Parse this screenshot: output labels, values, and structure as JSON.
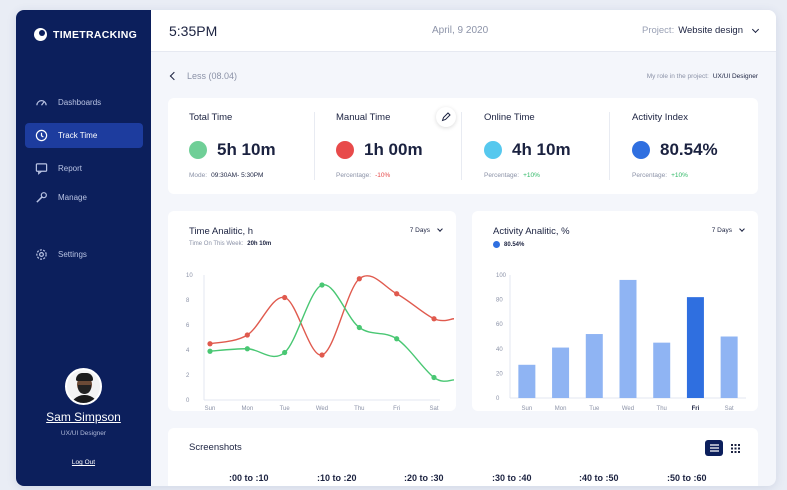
{
  "app": {
    "logo_text": "TIMETRACKING",
    "time": "5:35PM",
    "date": "April, 9 2020",
    "project_label": "Project:",
    "project_value": "Website design"
  },
  "sidebar": {
    "items": [
      {
        "label": "Dashboards",
        "icon": "speedometer-icon",
        "active": false
      },
      {
        "label": "Track Time",
        "icon": "clock-icon",
        "active": true
      },
      {
        "label": "Report",
        "icon": "chat-icon",
        "active": false
      },
      {
        "label": "Manage",
        "icon": "wrench-icon",
        "active": false
      },
      {
        "label": "Settings",
        "icon": "gear-icon",
        "active": false
      }
    ],
    "user_name": "Sam Simpson",
    "user_role": "UX/UI Designer",
    "logout": "Log Out"
  },
  "subheader": {
    "back_label": "Less (08.04)",
    "role_label": "My role in the project:",
    "role_value": "UX/UI Designer"
  },
  "stats": [
    {
      "title": "Total Time",
      "value": "5h 10m",
      "color": "#6fcf97",
      "sub_label": "Mode:",
      "sub_value": "09:30AM- 5:30PM",
      "sub_kind": "v"
    },
    {
      "title": "Manual Time",
      "value": "1h 00m",
      "color": "#e84a4a",
      "sub_label": "Percentage:",
      "sub_value": "-10%",
      "sub_kind": "neg"
    },
    {
      "title": "Online Time",
      "value": "4h 10m",
      "color": "#56c8ee",
      "sub_label": "Percentage:",
      "sub_value": "+10%",
      "sub_kind": "pos"
    },
    {
      "title": "Activity Index",
      "value": "80.54%",
      "color": "#2f6fe0",
      "sub_label": "Percentage:",
      "sub_value": "+10%",
      "sub_kind": "pos"
    }
  ],
  "time_card": {
    "title": "Time Analitic, h",
    "sub_label": "Time On This Week:",
    "sub_value": "20h 10m",
    "range": "7 Days"
  },
  "activity_card": {
    "title": "Activity Analitic, %",
    "legend": "80.54%",
    "range": "7 Days"
  },
  "chart_data": [
    {
      "type": "line",
      "x": [
        "Sun",
        "Mon",
        "Tue",
        "Wed",
        "Thu",
        "Fri",
        "Sat"
      ],
      "ylim": [
        0,
        10
      ],
      "yticks": [
        0,
        2,
        4,
        6,
        8,
        10
      ],
      "series": [
        {
          "color": "#e05a4e",
          "values": [
            4.5,
            5.2,
            8.2,
            3.6,
            9.7,
            8.5,
            6.5
          ],
          "end": 6.5
        },
        {
          "color": "#49c773",
          "values": [
            3.9,
            4.1,
            3.8,
            9.2,
            5.8,
            4.9,
            1.8
          ],
          "end": 1.6
        }
      ]
    },
    {
      "type": "bar",
      "categories": [
        "Sun",
        "Mon",
        "Tue",
        "Wed",
        "Thu",
        "Fri",
        "Sat"
      ],
      "values": [
        27,
        41,
        52,
        96,
        45,
        82,
        50
      ],
      "highlight": "Fri",
      "ylim": [
        0,
        100
      ],
      "yticks": [
        0,
        20,
        40,
        60,
        80,
        100
      ],
      "bar_color": "#8fb4f3",
      "highlight_color": "#2f6fe0"
    }
  ],
  "screenshots": {
    "title": "Screenshots",
    "slots": [
      ":00 to :10",
      ":10 to :20",
      ":20 to :30",
      ":30 to :40",
      ":40 to :50",
      ":50 to :60"
    ]
  }
}
